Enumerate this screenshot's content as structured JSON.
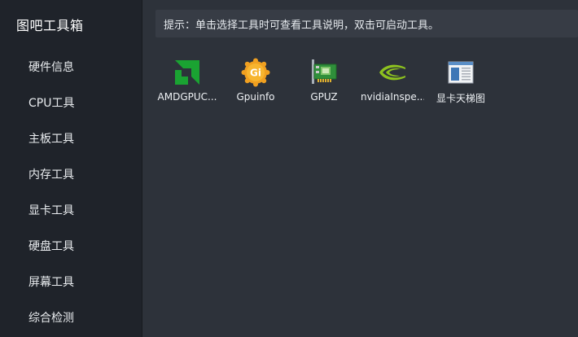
{
  "app": {
    "title": "图吧工具箱"
  },
  "sidebar": {
    "items": [
      {
        "label": "硬件信息"
      },
      {
        "label": "CPU工具"
      },
      {
        "label": "主板工具"
      },
      {
        "label": "内存工具"
      },
      {
        "label": "显卡工具"
      },
      {
        "label": "硬盘工具"
      },
      {
        "label": "屏幕工具"
      },
      {
        "label": "综合检测"
      }
    ]
  },
  "main": {
    "hint": "提示：单击选择工具时可查看工具说明，双击可启动工具。",
    "tools": [
      {
        "label": "AMDGPUC...",
        "icon": "amd-logo-icon"
      },
      {
        "label": "Gpuinfo",
        "icon": "gpuinfo-badge-icon"
      },
      {
        "label": "GPUZ",
        "icon": "graphics-card-icon"
      },
      {
        "label": "nvidiaInspe...",
        "icon": "nvidia-logo-icon"
      },
      {
        "label": "显卡天梯图",
        "icon": "window-chart-icon"
      }
    ]
  },
  "colors": {
    "sidebar_bg": "#1f232a",
    "main_bg": "#2d323a",
    "hint_bg": "#373c45",
    "amd_green": "#1aa332",
    "nvidia_green": "#8dc21f",
    "gpuinfo_orange": "#f0a020"
  }
}
